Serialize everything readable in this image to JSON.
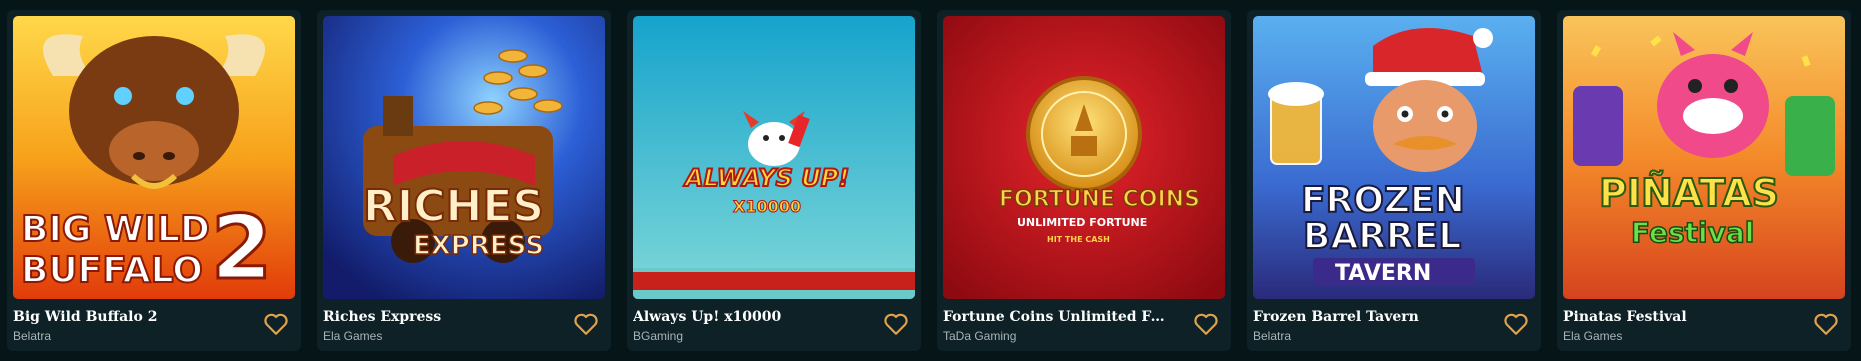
{
  "games": [
    {
      "title": "Big Wild Buffalo 2",
      "provider": "Belatra",
      "art": {
        "line1": "BIG WILD",
        "line2": "BUFFALO",
        "number": "2"
      },
      "colors": {
        "bg_top": "#f7a21b",
        "bg_bottom": "#e23b0a"
      }
    },
    {
      "title": "Riches Express",
      "provider": "Ela Games",
      "art": {
        "line1": "RICHES",
        "line2": "EXPRESS"
      },
      "colors": {
        "bg_top": "#2c5fd6",
        "bg_bottom": "#1a2c8a"
      }
    },
    {
      "title": "Always Up! x10000",
      "provider": "BGaming",
      "art": {
        "line1": "ALWAYS UP!",
        "line2": "X10000"
      },
      "colors": {
        "bg_top": "#1fa9c9",
        "bg_bottom": "#5fc9d8"
      }
    },
    {
      "title": "Fortune Coins Unlimited Fortu...",
      "provider": "TaDa Gaming",
      "art": {
        "line1": "FORTUNE COINS",
        "line2": "UNLIMITED FORTUNE",
        "line3": "HIT THE CASH"
      },
      "colors": {
        "bg_top": "#c8121a",
        "bg_bottom": "#8d0a10"
      }
    },
    {
      "title": "Frozen Barrel Tavern",
      "provider": "Belatra",
      "art": {
        "line1": "FROZEN",
        "line2": "BARREL",
        "line3": "TAVERN"
      },
      "colors": {
        "bg_top": "#3a8fd8",
        "bg_bottom": "#2a2a7a"
      }
    },
    {
      "title": "Pinatas Festival",
      "provider": "Ela Games",
      "art": {
        "line1": "PIÑATAS",
        "line2": "Festival"
      },
      "colors": {
        "bg_top": "#f48a2a",
        "bg_bottom": "#d6431e"
      }
    }
  ],
  "accent_color": "#e0a24a"
}
